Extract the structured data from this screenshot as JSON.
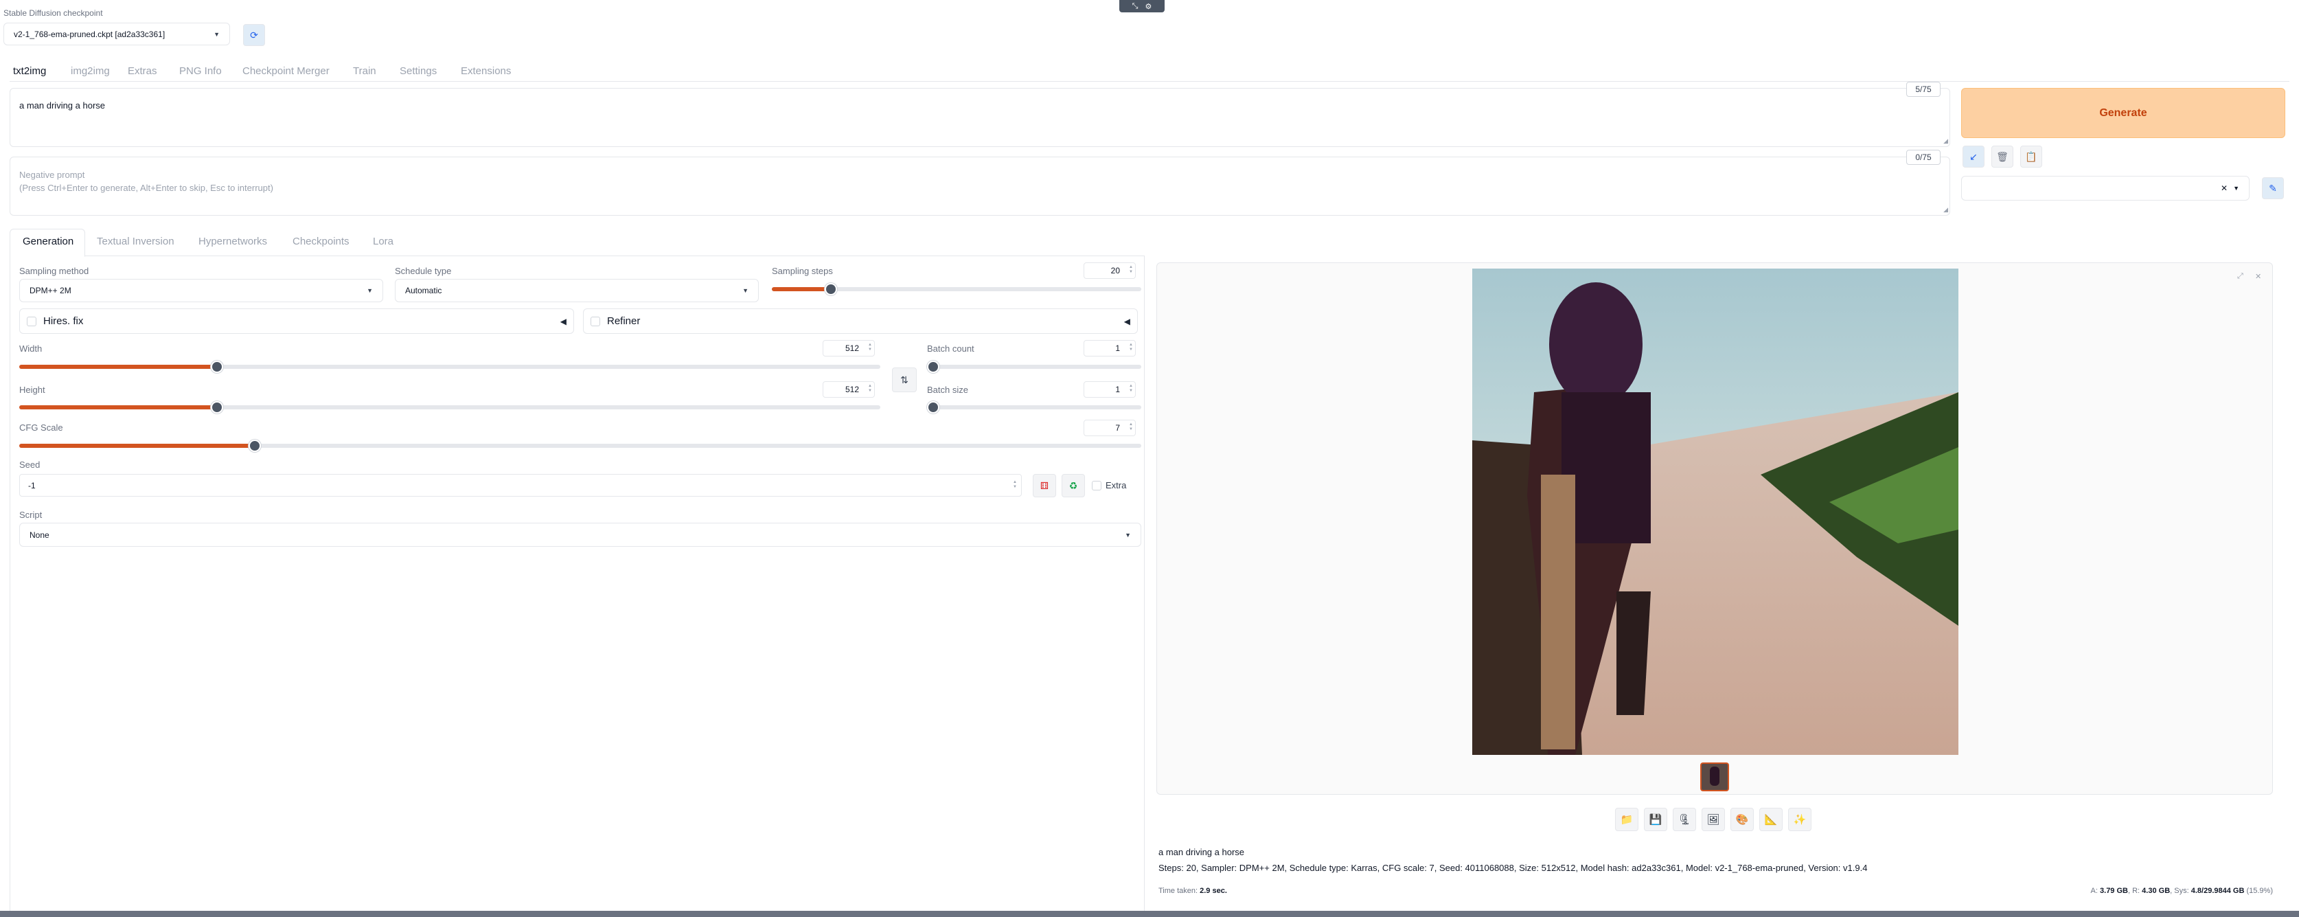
{
  "checkpoint": {
    "label": "Stable Diffusion checkpoint",
    "value": "v2-1_768-ema-pruned.ckpt [ad2a33c361]"
  },
  "top_toggle": {
    "left_icon": "expand-icon",
    "right_icon": "settings-icon"
  },
  "tabs": [
    "txt2img",
    "img2img",
    "Extras",
    "PNG Info",
    "Checkpoint Merger",
    "Train",
    "Settings",
    "Extensions"
  ],
  "prompt": {
    "value": "a man driving a horse",
    "counter": "5/75"
  },
  "negative_prompt": {
    "placeholder_line1": "Negative prompt",
    "placeholder_line2": "(Press Ctrl+Enter to generate, Alt+Enter to skip, Esc to interrupt)",
    "counter": "0/75"
  },
  "generate_label": "Generate",
  "subtabs": [
    "Generation",
    "Textual Inversion",
    "Hypernetworks",
    "Checkpoints",
    "Lora"
  ],
  "sampling_method": {
    "label": "Sampling method",
    "value": "DPM++ 2M"
  },
  "schedule_type": {
    "label": "Schedule type",
    "value": "Automatic"
  },
  "sampling_steps": {
    "label": "Sampling steps",
    "value": "20",
    "fraction": 0.16
  },
  "hires_fix": {
    "label": "Hires. fix"
  },
  "refiner": {
    "label": "Refiner"
  },
  "width": {
    "label": "Width",
    "value": "512",
    "fraction": 0.23
  },
  "height": {
    "label": "Height",
    "value": "512",
    "fraction": 0.23
  },
  "batch_count": {
    "label": "Batch count",
    "value": "1",
    "fraction": 0.0
  },
  "batch_size": {
    "label": "Batch size",
    "value": "1",
    "fraction": 0.0
  },
  "cfg_scale": {
    "label": "CFG Scale",
    "value": "7",
    "fraction": 0.21
  },
  "seed": {
    "label": "Seed",
    "value": "-1",
    "extra_label": "Extra"
  },
  "script": {
    "label": "Script",
    "value": "None"
  },
  "output": {
    "prompt_line": "a man driving a horse",
    "params_line": "Steps: 20, Sampler: DPM++ 2M, Schedule type: Karras, CFG scale: 7, Seed: 4011068088, Size: 512x512, Model hash: ad2a33c361, Model: v2-1_768-ema-pruned, Version: v1.9.4",
    "time_label": "Time taken:",
    "time_value": "2.9 sec.",
    "mem_a_label": "A:",
    "mem_a_value": "3.79 GB",
    "mem_r_label": "R:",
    "mem_r_value": "4.30 GB",
    "mem_sys_label": "Sys:",
    "mem_sys_value": "4.8/29.9844 GB",
    "mem_pct": "(15.9%)"
  },
  "tool_icons": [
    "folder-icon",
    "save-icon",
    "zip-icon",
    "image-icon",
    "palette-icon",
    "ruler-icon",
    "sparkle-icon"
  ],
  "colors": {
    "accent": "#d35420",
    "generate_bg": "#fdd0a2",
    "generate_text": "#c2410c"
  }
}
